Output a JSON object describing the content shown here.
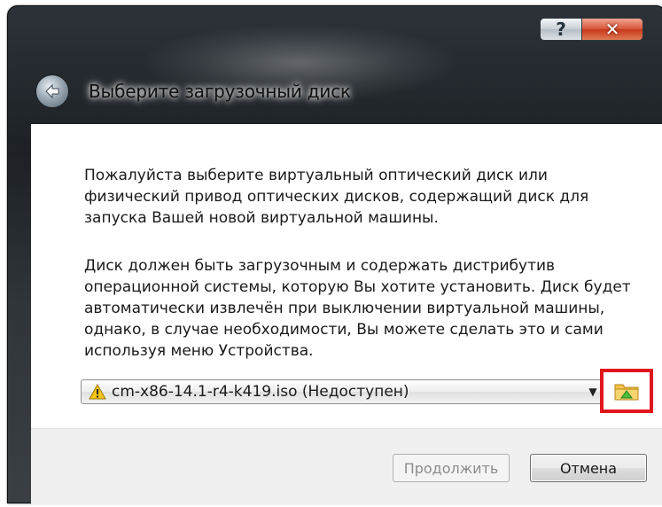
{
  "window": {
    "title": "Выберите загрузочный диск",
    "help_label": "?",
    "close_label": "✕"
  },
  "content": {
    "paragraph1": "Пожалуйста выберите виртуальный оптический диск или физический привод оптических дисков, содержащий диск для запуска Вашей новой виртуальной машины.",
    "paragraph2": "Диск должен быть загрузочным и содержать дистрибутив операционной системы, которую Вы хотите установить. Диск будет автоматически извлечён при выключении виртуальной машины, однако, в случае необходимости, Вы можете сделать это и сами используя меню Устройства."
  },
  "disk_selector": {
    "selected_value": "cm-x86-14.1-r4-k419.iso (Недоступен)",
    "warning_icon": "warning-icon",
    "browse_icon": "folder-icon",
    "highlight_color": "#e0161c"
  },
  "buttons": {
    "continue_label": "Продолжить",
    "cancel_label": "Отмена"
  }
}
